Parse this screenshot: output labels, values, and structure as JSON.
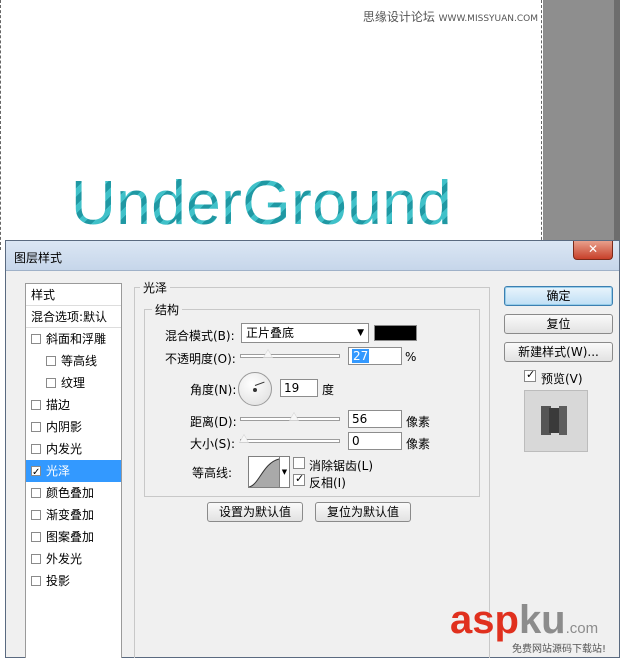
{
  "canvas": {
    "big_text": "UnderGround",
    "watermark_top_cn": "思缘设计论坛",
    "watermark_top_url": "WWW.MISSYUAN.COM"
  },
  "dialog": {
    "title": "图层样式",
    "close_glyph": "✕",
    "styles": {
      "header": "样式",
      "blend_options": "混合选项:默认",
      "items": [
        {
          "label": "斜面和浮雕",
          "checked": false
        },
        {
          "label": "等高线",
          "checked": false
        },
        {
          "label": "纹理",
          "checked": false
        },
        {
          "label": "描边",
          "checked": false
        },
        {
          "label": "内阴影",
          "checked": false
        },
        {
          "label": "内发光",
          "checked": false
        },
        {
          "label": "光泽",
          "checked": true
        },
        {
          "label": "颜色叠加",
          "checked": false
        },
        {
          "label": "渐变叠加",
          "checked": false
        },
        {
          "label": "图案叠加",
          "checked": false
        },
        {
          "label": "外发光",
          "checked": false
        },
        {
          "label": "投影",
          "checked": false
        }
      ]
    },
    "satin": {
      "group_title": "光泽",
      "structure_title": "结构",
      "blend_mode_label": "混合模式(B):",
      "blend_mode_value": "正片叠底",
      "blend_color": "#000000",
      "opacity_label": "不透明度(O):",
      "opacity_value": "27",
      "opacity_unit": "%",
      "angle_label": "角度(N):",
      "angle_value": "19",
      "angle_unit": "度",
      "distance_label": "距离(D):",
      "distance_value": "56",
      "distance_unit": "像素",
      "size_label": "大小(S):",
      "size_value": "0",
      "size_unit": "像素",
      "contour_label": "等高线:",
      "antialias_label": "消除锯齿(L)",
      "antialias_checked": false,
      "invert_label": "反相(I)",
      "invert_checked": true,
      "make_default": "设置为默认值",
      "reset_default": "复位为默认值"
    },
    "buttons": {
      "ok": "确定",
      "reset": "复位",
      "new_style": "新建样式(W)...",
      "preview_label": "预览(V)",
      "preview_checked": true
    }
  },
  "site_logo": {
    "asp": "asp",
    "ku": "ku",
    "com": ".com",
    "sub": "免费网站源码下载站!"
  }
}
